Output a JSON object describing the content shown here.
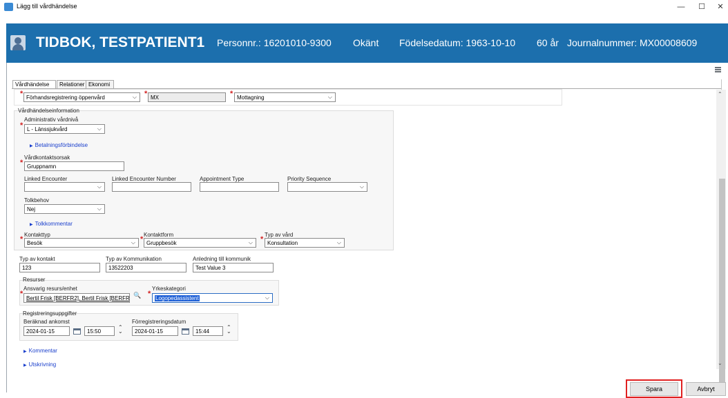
{
  "window": {
    "title": "Lägg till vårdhändelse",
    "minimize": "—",
    "maximize": "☐",
    "close": "✕"
  },
  "patient": {
    "name": "TIDBOK, TESTPATIENT1",
    "personnr": "Personnr.: 16201010-9300",
    "gender": "Okänt",
    "dob": "Födelsedatum: 1963-10-10",
    "age": "60 år",
    "journal": "Journalnummer: MX00008609"
  },
  "tabs": [
    "Vårdhändelse",
    "Relationer",
    "Ekonomi"
  ],
  "top_row": {
    "type_value": "Förhandsregistrering öppenvård",
    "unit_value": "MX",
    "visit_value": "Mottagning"
  },
  "section": {
    "title": "Vårdhändelseinformation",
    "admin_level_label": "Administrativ vårdnivå",
    "admin_level_value": "L - Länssjukvård",
    "payment_link": "Betalningsförbindelse",
    "reason_label": "Vårdkontaktsorsak",
    "reason_value": "Gruppnamn",
    "linked_encounter_label": "Linked Encounter",
    "linked_encounter_number_label": "Linked Encounter Number",
    "appointment_type_label": "Appointment Type",
    "priority_sequence_label": "Priority Sequence",
    "interpreter_label": "Tolkbehov",
    "interpreter_value": "Nej",
    "interpreter_comment_link": "Tolkkommentar",
    "contact_type_label": "Kontakttyp",
    "contact_type_value": "Besök",
    "contact_form_label": "Kontaktform",
    "contact_form_value": "Gruppbesök",
    "care_type_label": "Typ av vård",
    "care_type_value": "Konsultation"
  },
  "contact": {
    "type_label": "Typ av kontakt",
    "type_value": "123",
    "comm_label": "Typ av Kommunikation",
    "comm_value": "13522203",
    "reason_label": "Anledning till kommunik",
    "reason_value": "Test Value 3"
  },
  "resources": {
    "title": "Resurser",
    "responsible_label": "Ansvarig resurs/enhet",
    "responsible_value": "Bertil Frisk [BERFR2], Bertil Frisk [BERFR",
    "profession_label": "Yrkeskategori",
    "profession_value": "Logopedassistent"
  },
  "registration": {
    "title": "Registreringsuppgifter",
    "arrival_label": "Beräknad ankomst",
    "arrival_date": "2024-01-15",
    "arrival_time": "15:50",
    "prereg_label": "Förregistreringsdatum",
    "prereg_date": "2024-01-15",
    "prereg_time": "15:44"
  },
  "links": {
    "comment": "Kommentar",
    "discharge": "Utskrivning"
  },
  "buttons": {
    "save": "Spara",
    "cancel": "Avbryt"
  },
  "colors": {
    "header_bg": "#1c6fad",
    "highlight": "#e02020",
    "selection": "#1d5fd6"
  }
}
